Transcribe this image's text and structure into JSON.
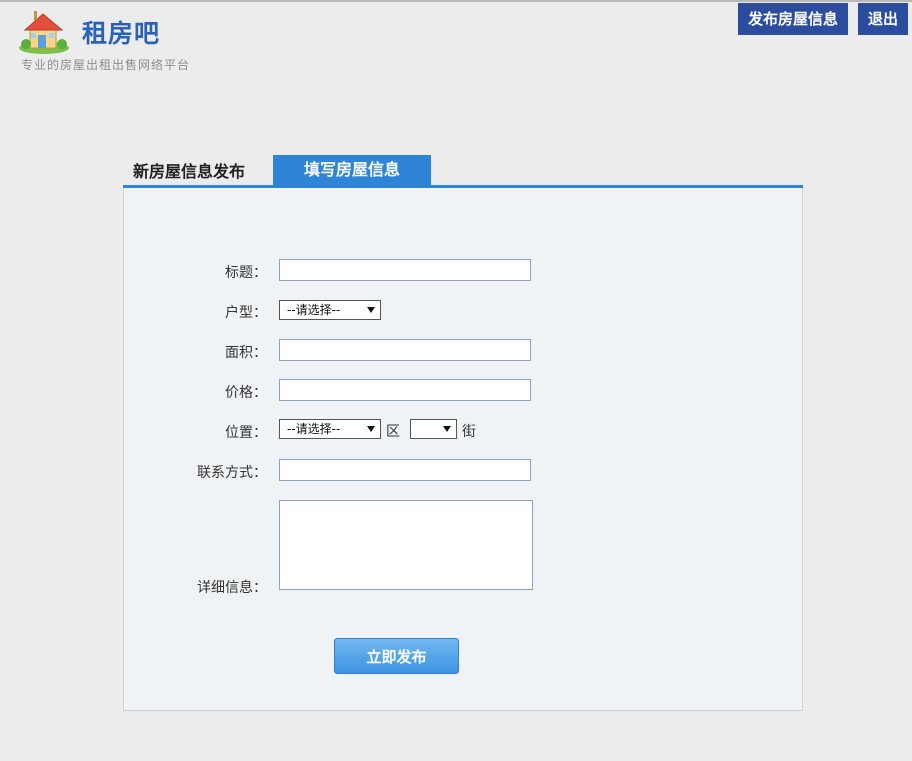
{
  "header": {
    "brand": "租房吧",
    "tagline": "专业的房屋出租出售网络平台",
    "publish_button": "发布房屋信息",
    "logout_button": "退出"
  },
  "panel": {
    "title": "新房屋信息发布",
    "tab": "填写房屋信息"
  },
  "form": {
    "title_label": "标题：",
    "type_label": "户型：",
    "type_value": "--请选择--",
    "area_label": "面积：",
    "price_label": "价格：",
    "location_label": "位置：",
    "district_value": "--请选择--",
    "district_unit": "区",
    "street_value": "",
    "street_unit": "街",
    "contact_label": "联系方式：",
    "detail_label": "详细信息：",
    "submit_label": "立即发布"
  },
  "colors": {
    "accent": "#2e84d6",
    "header_button": "#2c4d9e",
    "brand": "#2a63b6"
  },
  "icons": {
    "logo": "house-logo-icon",
    "select_arrow": "chevron-down-icon"
  }
}
